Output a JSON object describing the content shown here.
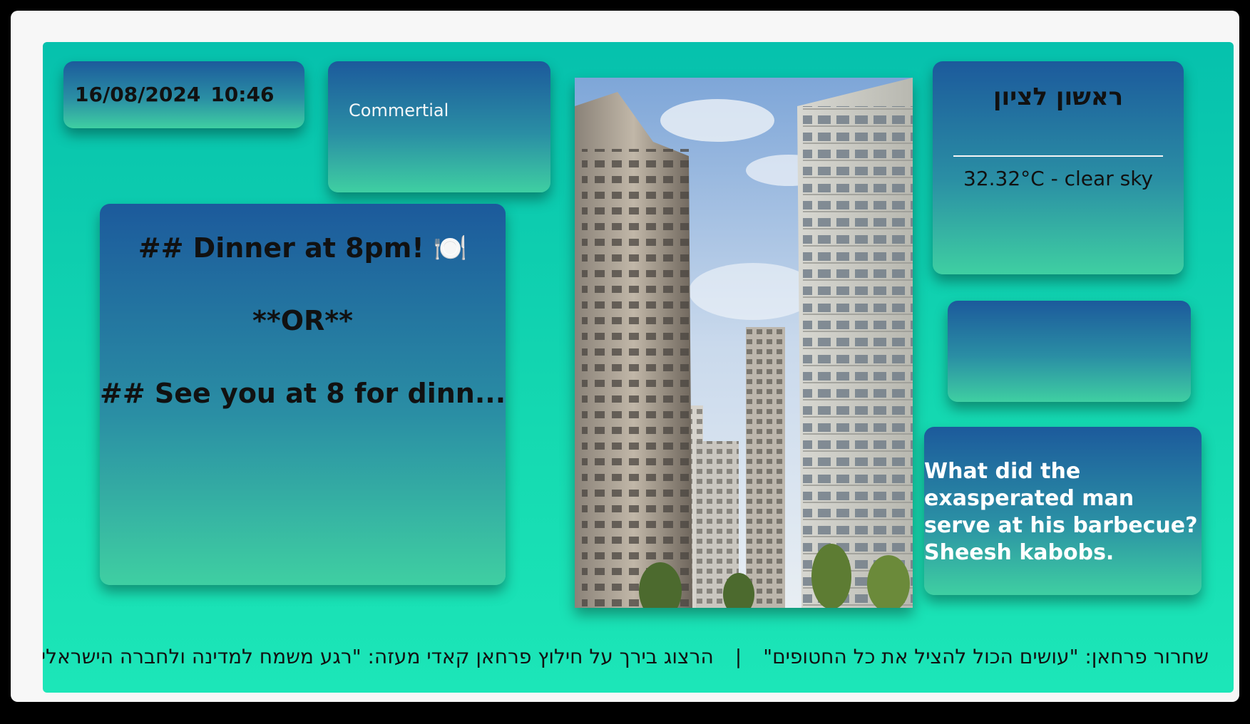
{
  "datetime": {
    "date": "16/08/2024",
    "time": "10:46"
  },
  "commercial": {
    "label": "Commertial"
  },
  "message": {
    "line1": "##  Dinner at 8pm! 🍽️",
    "line2": "**OR**",
    "line3": "##  See you at 8 for dinn..."
  },
  "weather": {
    "city": "ראשון לציון",
    "temp": "32.32°C - clear sky"
  },
  "joke": {
    "text": "What did the exasperated man serve at his barbecue? Sheesh kabobs."
  },
  "ticker": {
    "item1": "שחרור פרחאן: \"עושים הכול להציל את כל החטופים\"",
    "separator": "|",
    "item2": "הרצוג בירך על חילוץ פרחאן קאדי מעזה: \"רגע משמח למדינה ולחברה הישראלית"
  },
  "photo": {
    "icon": "apartment-towers-photo"
  },
  "colors": {
    "background": "#15d9b1",
    "card_top": "#1c5a9c",
    "card_bottom": "#3fcfa2"
  }
}
